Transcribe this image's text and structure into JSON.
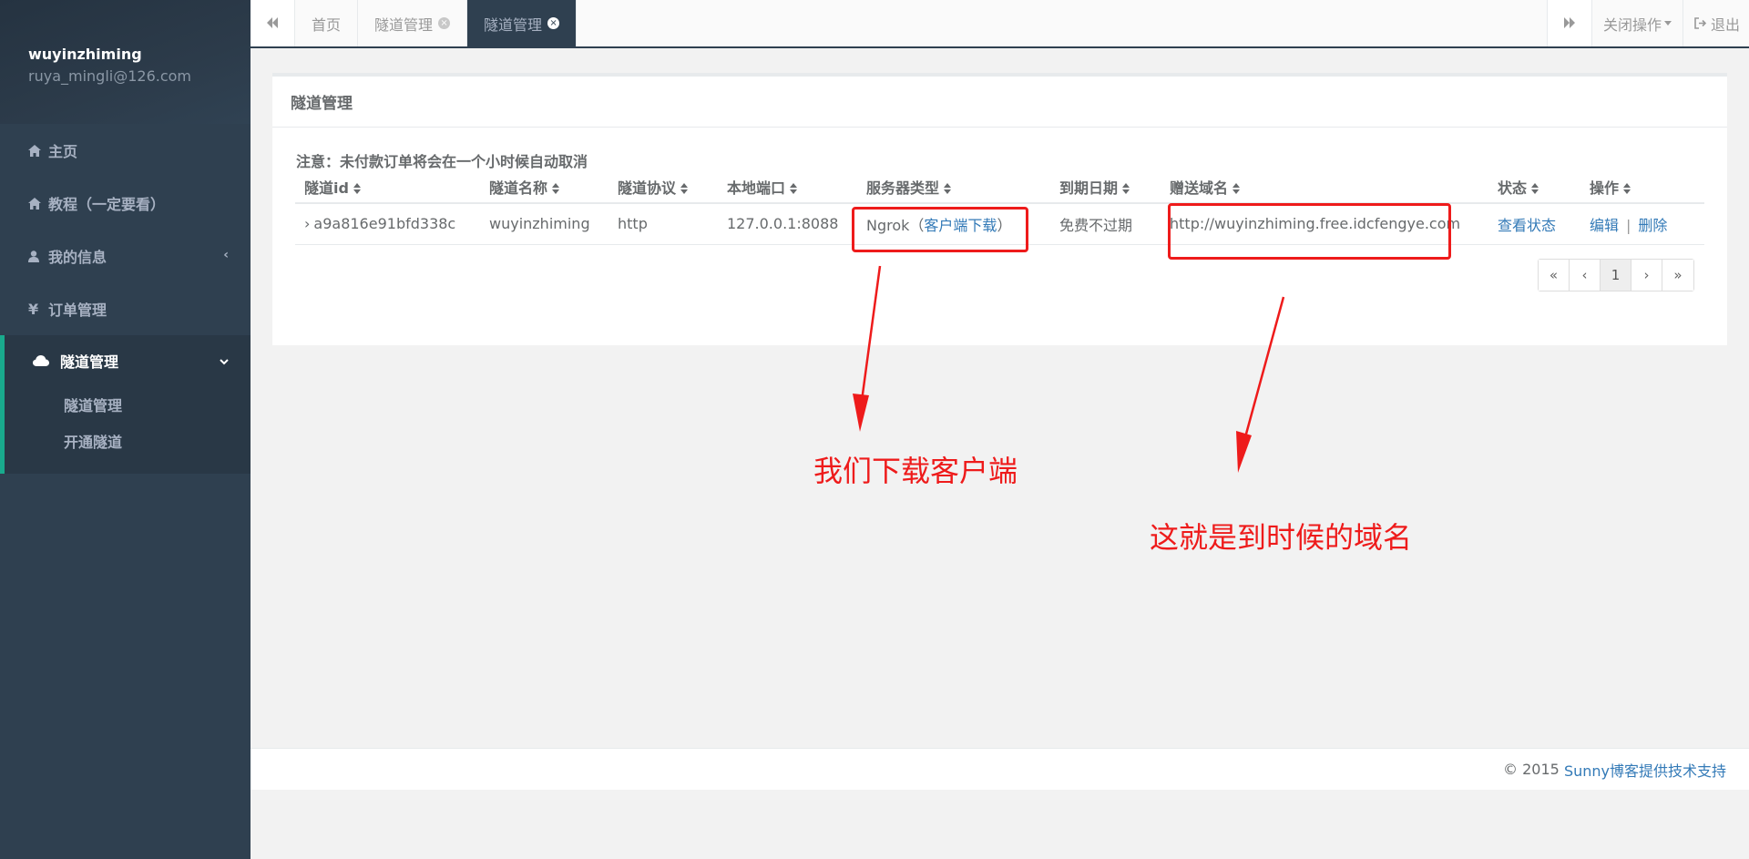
{
  "sidebar": {
    "user_name": "wuyinzhiming",
    "user_email": "ruya_mingli@126.com",
    "items": [
      {
        "label": "主页",
        "icon": "home-icon"
      },
      {
        "label": "教程（一定要看）",
        "icon": "home-icon"
      },
      {
        "label": "我的信息",
        "icon": "user-icon",
        "arrow": "‹"
      },
      {
        "label": "订单管理",
        "icon": "yen-icon"
      }
    ],
    "active_group": {
      "label": "隧道管理",
      "icon": "cloud-icon",
      "arrow": "⌄",
      "children": [
        {
          "label": "隧道管理"
        },
        {
          "label": "开通隧道"
        }
      ]
    }
  },
  "tabbar": {
    "tabs": [
      {
        "label": "首页"
      },
      {
        "label": "隧道管理"
      },
      {
        "label": "隧道管理"
      }
    ],
    "close_ops_label": "关闭操作",
    "logout_label": "退出"
  },
  "panel": {
    "title": "隧道管理",
    "notice": "注意：未付款订单将会在一个小时候自动取消",
    "columns": [
      "隧道id",
      "隧道名称",
      "隧道协议",
      "本地端口",
      "服务器类型",
      "到期日期",
      "赠送域名",
      "状态",
      "操作"
    ],
    "rows": [
      {
        "id": "a9a816e91bfd338c",
        "name": "wuyinzhiming",
        "protocol": "http",
        "local_port": "127.0.0.1:8088",
        "server_type": "Ngrok",
        "client_download": "客户端下载",
        "expire": "免费不过期",
        "domain": "http://wuyinzhiming.free.idcfengye.com",
        "status_link": "查看状态",
        "edit_link": "编辑",
        "delete_link": "删除"
      }
    ],
    "pagination": [
      "«",
      "‹",
      "1",
      "›",
      "»"
    ]
  },
  "annotations": {
    "download_note": "我们下载客户端",
    "domain_note": "这就是到时候的域名",
    "color": "#ee1b1b"
  },
  "footer": {
    "copyright": "© 2015",
    "link": "Sunny博客提供技术支持"
  },
  "colors": {
    "sidebar_bg": "#2f4050",
    "accent": "#19aa8d",
    "link": "#337ab7"
  }
}
